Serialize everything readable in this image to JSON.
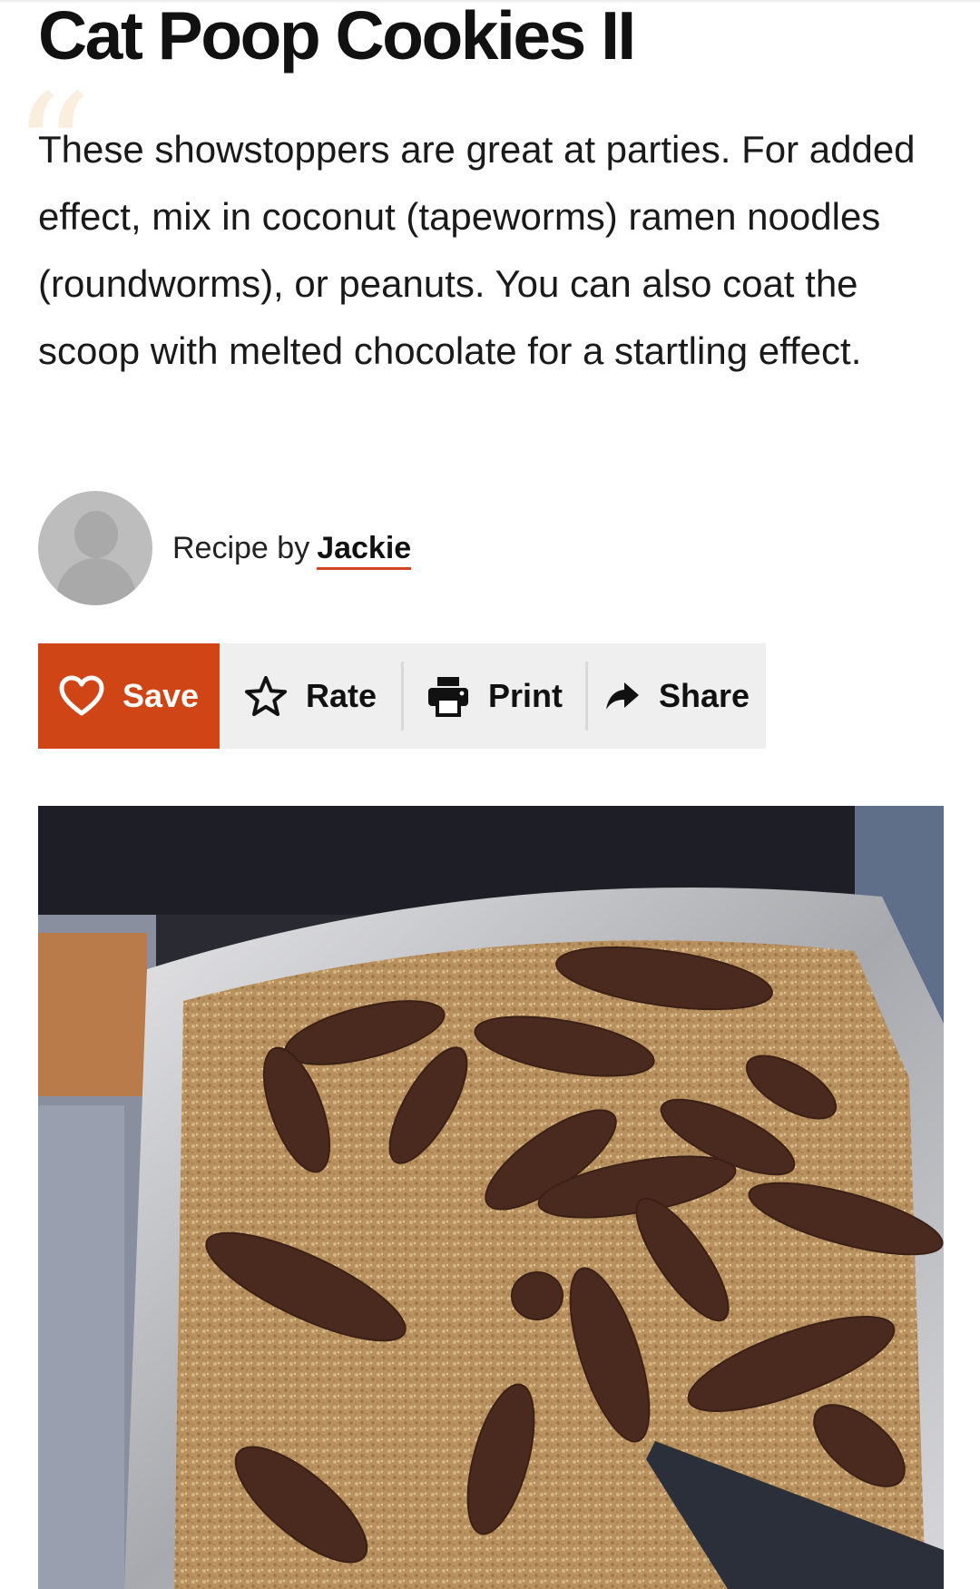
{
  "recipe": {
    "title": "Cat Poop Cookies II",
    "description": "These showstoppers are great at parties. For added effect, mix in coconut (tapeworms) ramen noodles (roundworms), or peanuts. You can also coat the scoop with melted chocolate for a startling effect.",
    "quote_glyph": "“"
  },
  "author": {
    "prefix": "Recipe by",
    "name": "Jackie",
    "avatar_icon": "person-placeholder-icon"
  },
  "actions": {
    "save": {
      "label": "Save",
      "icon": "heart-icon"
    },
    "rate": {
      "label": "Rate",
      "icon": "star-icon"
    },
    "print": {
      "label": "Print",
      "icon": "printer-icon"
    },
    "share": {
      "label": "Share",
      "icon": "share-arrow-icon"
    }
  },
  "photo": {
    "subject": "recipe-photo"
  },
  "colors": {
    "accent": "#d04516",
    "action_bar_bg": "#efefef",
    "quote_mark": "#faeede",
    "text": "#111111"
  }
}
